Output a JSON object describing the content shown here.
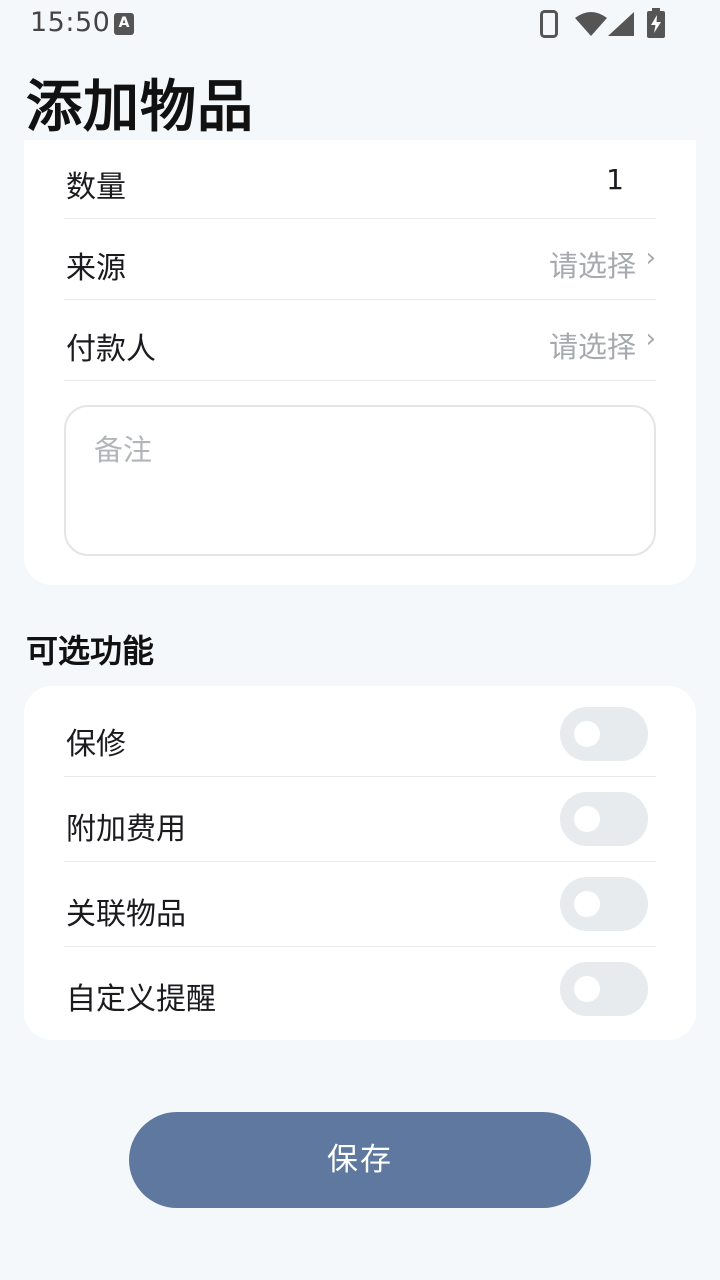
{
  "status_bar": {
    "time": "15:50",
    "notification_icon": "A",
    "icons": [
      "phone-icon",
      "wifi-icon",
      "signal-icon",
      "battery-charging-icon"
    ]
  },
  "page": {
    "title": "添加物品"
  },
  "details": {
    "quantity": {
      "label": "数量",
      "value": "1"
    },
    "source": {
      "label": "来源",
      "placeholder": "请选择",
      "chevron": "›"
    },
    "payer": {
      "label": "付款人",
      "placeholder": "请选择",
      "chevron": "›"
    },
    "notes": {
      "placeholder": "备注",
      "value": ""
    }
  },
  "optional": {
    "title": "可选功能",
    "items": [
      {
        "label": "保修",
        "enabled": false
      },
      {
        "label": "附加费用",
        "enabled": false
      },
      {
        "label": "关联物品",
        "enabled": false
      },
      {
        "label": "自定义提醒",
        "enabled": false
      }
    ]
  },
  "actions": {
    "save_label": "保存"
  },
  "colors": {
    "background": "#f5f8fb",
    "card": "#ffffff",
    "primary_button": "#5f789f",
    "toggle_off": "#e7ebee",
    "placeholder": "#a6a9ae"
  }
}
